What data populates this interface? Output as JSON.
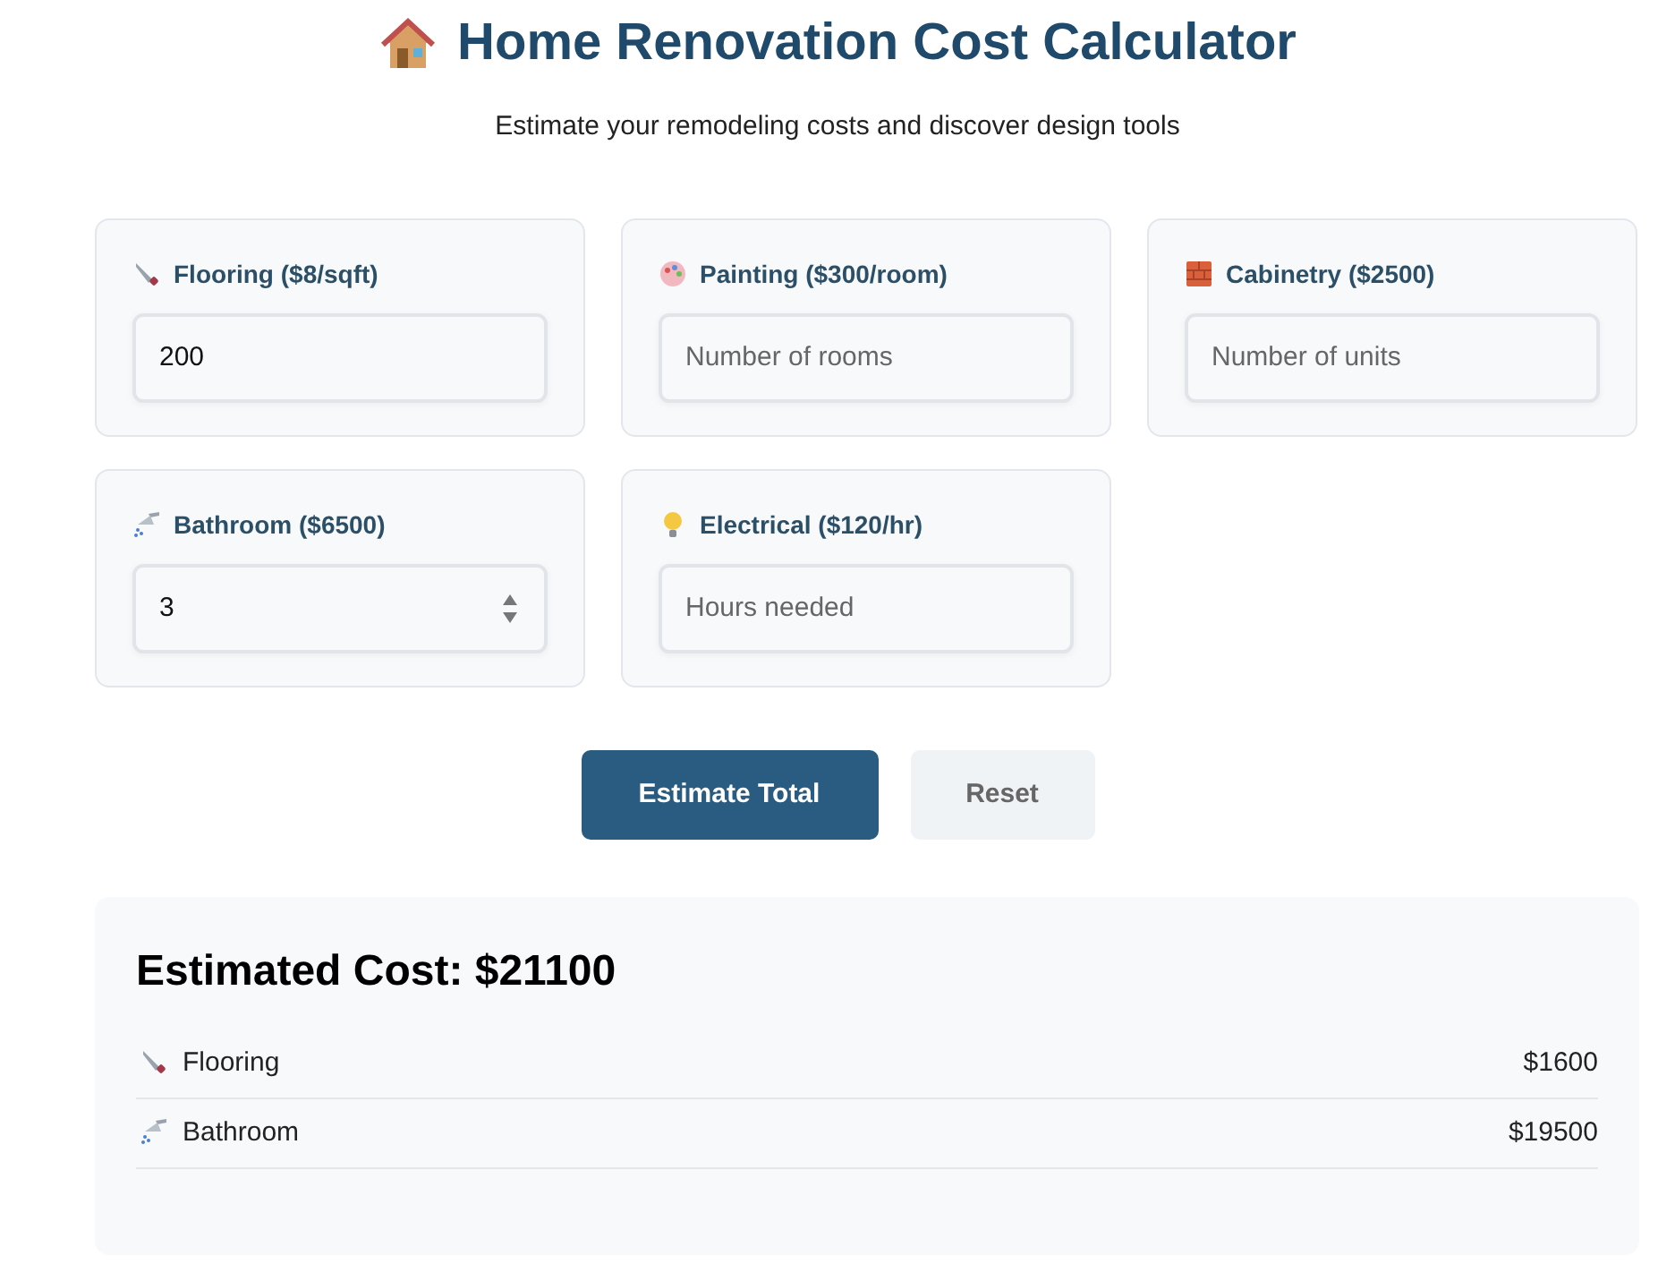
{
  "header": {
    "title": "Home Renovation Cost Calculator",
    "subtitle": "Estimate your remodeling costs and discover design tools"
  },
  "fields": [
    {
      "kind": "saw",
      "label": "Flooring ($8/sqft)",
      "value": "200",
      "spinner": false
    },
    {
      "kind": "palette",
      "label": "Painting ($300/room)",
      "placeholder": "Number of rooms",
      "spinner": false
    },
    {
      "kind": "brick",
      "label": "Cabinetry ($2500)",
      "placeholder": "Number of units",
      "spinner": false
    },
    {
      "kind": "shower",
      "label": "Bathroom ($6500)",
      "value": "3",
      "spinner": true
    },
    {
      "kind": "bulb",
      "label": "Electrical ($120/hr)",
      "placeholder": "Hours needed",
      "spinner": false
    }
  ],
  "buttons": [
    {
      "kind": "primary",
      "label": "Estimate Total"
    },
    {
      "kind": "secondary",
      "label": "Reset"
    }
  ],
  "result": {
    "title": "Estimated Cost: $21100",
    "rows": [
      {
        "kind": "saw",
        "name": "Flooring",
        "amount": "$1600"
      },
      {
        "kind": "shower",
        "name": "Bathroom",
        "amount": "$19500"
      }
    ]
  }
}
